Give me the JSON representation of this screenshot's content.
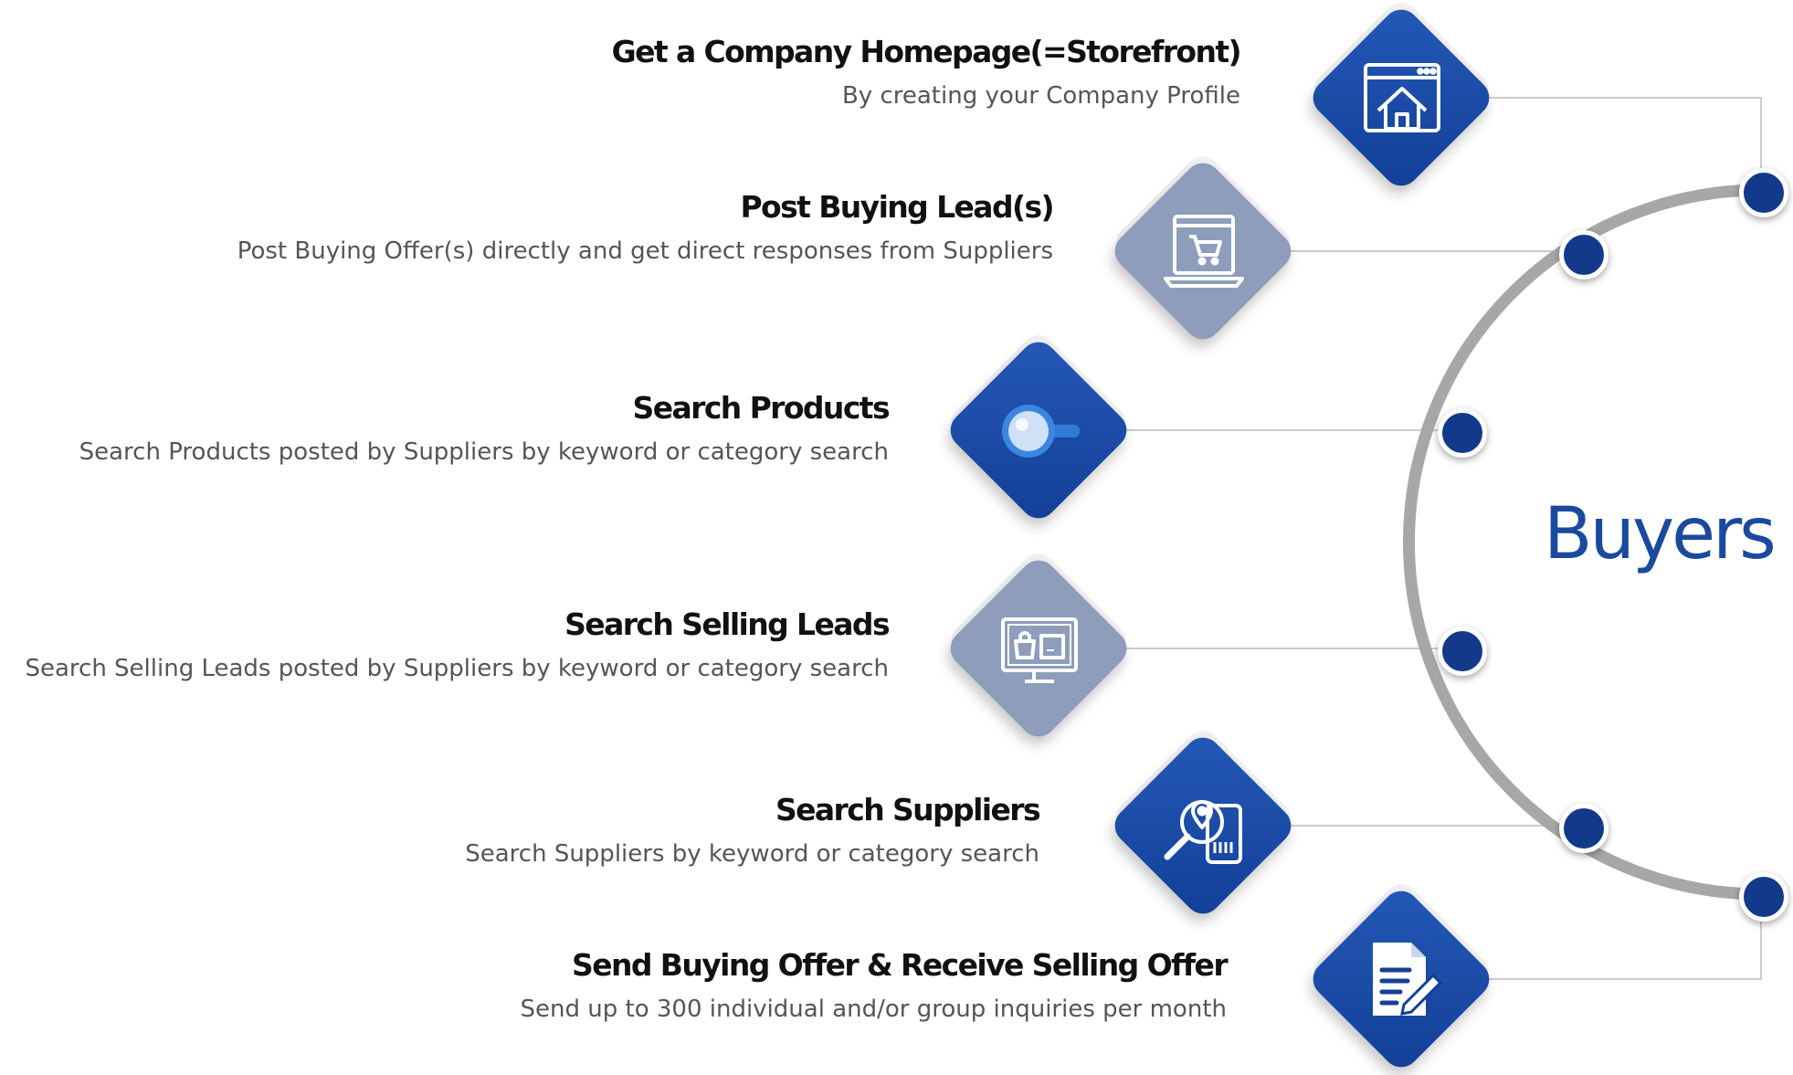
{
  "audience": {
    "label": "Buyers"
  },
  "colors": {
    "primary": "#133a8a",
    "accent": "#2459b8",
    "muted": "#8d9dbb",
    "arc": "#a7a7a7",
    "connector": "#cccccc"
  },
  "features": [
    {
      "title": "Get a Company Homepage(=Storefront)",
      "description": "By creating your Company Profile",
      "icon": "storefront-icon",
      "tile": "dark"
    },
    {
      "title": "Post Buying Lead(s)",
      "description": "Post Buying Offer(s) directly  and get direct responses from Suppliers",
      "icon": "shopping-cart-laptop-icon",
      "tile": "light"
    },
    {
      "title": "Search Products",
      "description": "Search Products posted by Suppliers by keyword or category search",
      "icon": "magnifier-icon",
      "tile": "dark"
    },
    {
      "title": "Search Selling Leads",
      "description": "Search Selling Leads posted by Suppliers by keyword or category search",
      "icon": "monitor-product-icon",
      "tile": "light"
    },
    {
      "title": "Search Suppliers",
      "description": "Search Suppliers by keyword or category search",
      "icon": "location-search-icon",
      "tile": "dark"
    },
    {
      "title": "Send Buying Offer & Receive Selling Offer",
      "description": "Send up to 300 individual and/or group inquiries per month",
      "icon": "document-edit-icon",
      "tile": "dark"
    }
  ]
}
